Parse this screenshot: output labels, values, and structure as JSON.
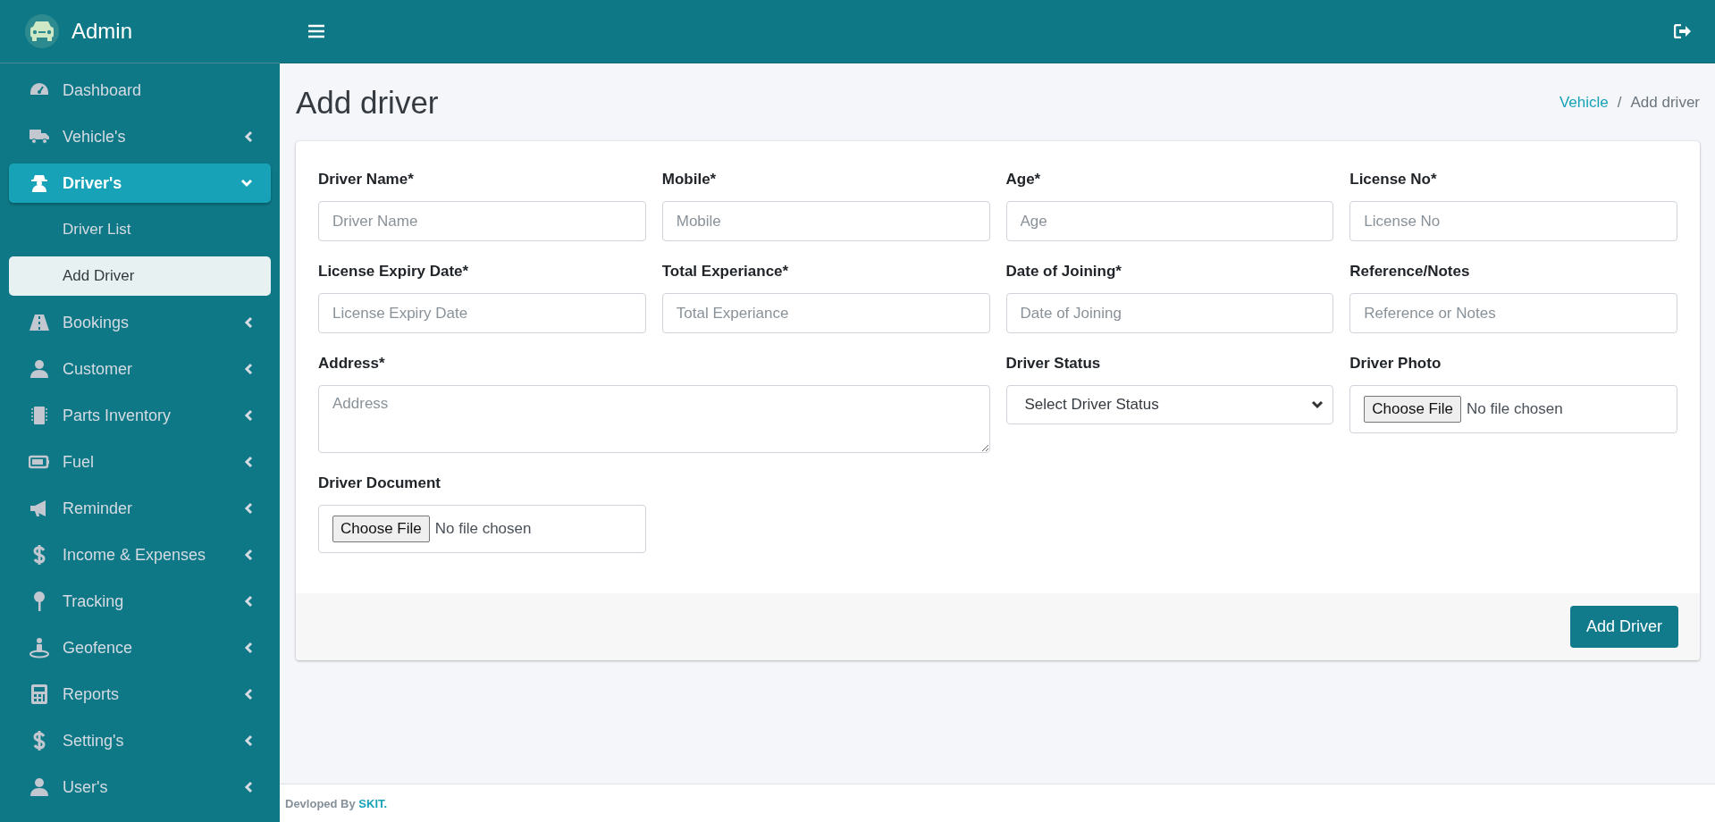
{
  "brand": {
    "title": "Admin"
  },
  "sidebar": {
    "items": [
      {
        "label": "Dashboard",
        "has_submenu": false,
        "selected": false
      },
      {
        "label": "Vehicle's",
        "has_submenu": true,
        "expanded": false,
        "selected": false
      },
      {
        "label": "Driver's",
        "has_submenu": true,
        "expanded": true,
        "selected": true,
        "children": [
          {
            "label": "Driver List",
            "selected": false
          },
          {
            "label": "Add Driver",
            "selected": true
          }
        ]
      },
      {
        "label": "Bookings",
        "has_submenu": true,
        "expanded": false,
        "selected": false
      },
      {
        "label": "Customer",
        "has_submenu": true,
        "expanded": false,
        "selected": false
      },
      {
        "label": "Parts Inventory",
        "has_submenu": true,
        "expanded": false,
        "selected": false
      },
      {
        "label": "Fuel",
        "has_submenu": true,
        "expanded": false,
        "selected": false
      },
      {
        "label": "Reminder",
        "has_submenu": true,
        "expanded": false,
        "selected": false
      },
      {
        "label": "Income & Expenses",
        "has_submenu": true,
        "expanded": false,
        "selected": false
      },
      {
        "label": "Tracking",
        "has_submenu": true,
        "expanded": false,
        "selected": false
      },
      {
        "label": "Geofence",
        "has_submenu": true,
        "expanded": false,
        "selected": false
      },
      {
        "label": "Reports",
        "has_submenu": true,
        "expanded": false,
        "selected": false
      },
      {
        "label": "Setting's",
        "has_submenu": true,
        "expanded": false,
        "selected": false
      },
      {
        "label": "User's",
        "has_submenu": true,
        "expanded": false,
        "selected": false
      }
    ]
  },
  "page": {
    "title": "Add driver",
    "separator": "/",
    "breadcrumb": [
      {
        "label": "Vehicle",
        "link": true
      },
      {
        "label": "Add driver",
        "link": false
      }
    ]
  },
  "form": {
    "fields": [
      {
        "kind": "input",
        "label": "Driver Name*",
        "placeholder": "Driver Name"
      },
      {
        "kind": "input",
        "label": "Mobile*",
        "placeholder": "Mobile"
      },
      {
        "kind": "input",
        "label": "Age*",
        "placeholder": "Age"
      },
      {
        "kind": "input",
        "label": "License No*",
        "placeholder": "License No"
      },
      {
        "kind": "input",
        "label": "License Expiry Date*",
        "placeholder": "License Expiry Date"
      },
      {
        "kind": "input",
        "label": "Total Experiance*",
        "placeholder": "Total Experiance"
      },
      {
        "kind": "input",
        "label": "Date of Joining*",
        "placeholder": "Date of Joining"
      },
      {
        "kind": "input",
        "label": "Reference/Notes",
        "placeholder": "Reference or Notes"
      },
      {
        "kind": "textarea",
        "label": "Address*",
        "placeholder": "Address"
      },
      {
        "kind": "select",
        "label": "Driver Status",
        "value": "Select Driver Status"
      },
      {
        "kind": "file",
        "label": "Driver Photo",
        "button": "Choose File",
        "status": "No file chosen"
      },
      {
        "kind": "file",
        "label": "Driver Document",
        "button": "Choose File",
        "status": "No file chosen"
      }
    ],
    "submit": "Add Driver"
  },
  "footer": {
    "text": "Devloped By ",
    "link": "SKIT."
  }
}
